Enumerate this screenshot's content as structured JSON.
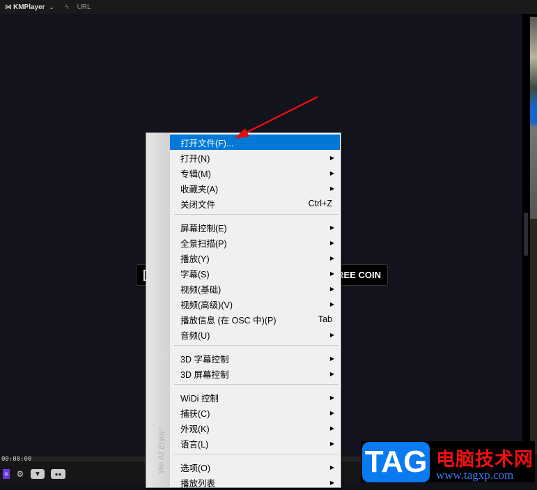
{
  "titlebar": {
    "app_name": "KMPlayer",
    "url_label": "URL"
  },
  "player": {
    "time": "00:00:00",
    "overlay_label": "FREE COIN"
  },
  "menu": {
    "side_text": "We All Enjoy!",
    "items": [
      {
        "label": "打开文件(F)...",
        "highlighted": true
      },
      {
        "label": "打开(N)",
        "submenu": true
      },
      {
        "label": "专辑(M)",
        "submenu": true
      },
      {
        "label": "收藏夹(A)",
        "submenu": true
      },
      {
        "label": "关闭文件",
        "shortcut": "Ctrl+Z"
      },
      {
        "label": "屏幕控制(E)",
        "submenu": true
      },
      {
        "label": "全景扫描(P)",
        "submenu": true
      },
      {
        "label": "播放(Y)",
        "submenu": true
      },
      {
        "label": "字幕(S)",
        "submenu": true
      },
      {
        "label": "视频(基础)",
        "submenu": true
      },
      {
        "label": "视频(高级)(V)",
        "submenu": true
      },
      {
        "label": "播放信息 (在 OSC 中)(P)",
        "shortcut": "Tab"
      },
      {
        "label": "音频(U)",
        "submenu": true
      },
      {
        "label": "3D 字幕控制",
        "submenu": true
      },
      {
        "label": "3D 屏幕控制",
        "submenu": true
      },
      {
        "label": "WiDi 控制",
        "submenu": true
      },
      {
        "label": "捕获(C)",
        "submenu": true
      },
      {
        "label": "外观(K)",
        "submenu": true
      },
      {
        "label": "语言(L)",
        "submenu": true
      },
      {
        "label": "选项(O)",
        "submenu": true
      },
      {
        "label": "播放列表",
        "submenu": true
      }
    ]
  },
  "watermark": {
    "logo": "TAG",
    "site_name": "电脑技术网",
    "site_url": "www.tagxp.com"
  },
  "colors": {
    "highlight": "#0078d7",
    "arrow": "#e01010",
    "tag_blue": "#0a7af0"
  }
}
